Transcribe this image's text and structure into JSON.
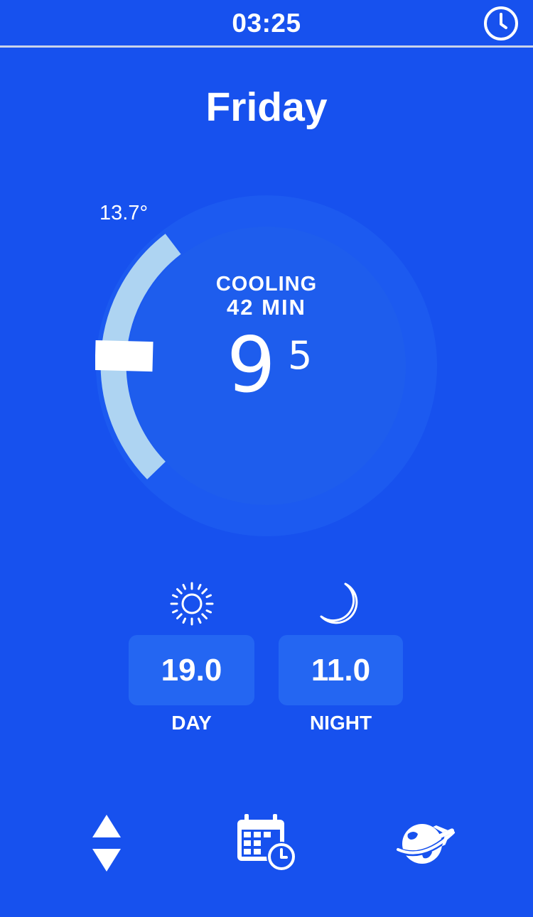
{
  "status_bar": {
    "time": "03:25",
    "clock_icon": "clock-icon"
  },
  "header": {
    "day": "Friday"
  },
  "dial": {
    "setpoint_label": "13.7°",
    "mode": "COOLING",
    "remaining": "42 MIN",
    "temp_integer": "9",
    "temp_decimal": "5",
    "colors": {
      "background": "#1751ee",
      "dial_outer": "#1c5af0",
      "dial_inner": "#1e5ded",
      "arc": "#aed4f2",
      "marker": "#ffffff"
    }
  },
  "presets": {
    "day": {
      "icon": "sun-icon",
      "value": "19.0",
      "label": "DAY"
    },
    "night": {
      "icon": "moon-icon",
      "value": "11.0",
      "label": "NIGHT"
    }
  },
  "bottom_bar": {
    "updown_icon": "up-down-arrows-icon",
    "schedule_icon": "calendar-clock-icon",
    "travel_icon": "globe-plane-icon"
  }
}
